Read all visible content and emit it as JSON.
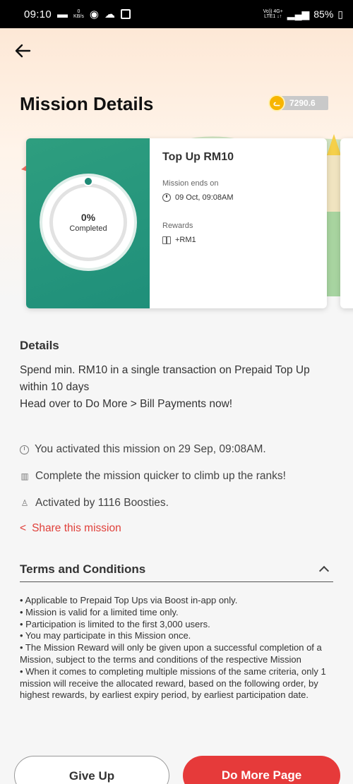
{
  "status_bar": {
    "time": "09:10",
    "notif_zero": "0",
    "notif_unit": "KB/s",
    "network_top": "Vo)) 4G+",
    "network_bottom": "LTE1 ↓↑",
    "battery": "85%"
  },
  "header": {
    "title": "Mission Details",
    "points": "7290.6"
  },
  "mission": {
    "progress_percent": "0%",
    "progress_label": "Completed",
    "title": "Top Up RM10",
    "ends_label": "Mission ends on",
    "ends_value": "09 Oct, 09:08AM",
    "rewards_label": "Rewards",
    "reward_value": "+RM1"
  },
  "details": {
    "title": "Details",
    "line1": "Spend min. RM10 in a single transaction on Prepaid Top Up within 10 days",
    "line2": "Head over to Do More > Bill Payments now!",
    "activated_on": "You activated this mission on 29 Sep, 09:08AM.",
    "ranks": "Complete the mission quicker to climb up the ranks!",
    "activated_by": "Activated by 1116 Boosties.",
    "share": "Share this mission"
  },
  "terms": {
    "title": "Terms and Conditions",
    "items": [
      "• Applicable to Prepaid Top Ups via Boost in-app only.",
      "• Mission is valid for a limited time only.",
      "• Participation is limited to the first 3,000 users.",
      "• You may participate in this Mission once.",
      "• The Mission Reward will only be given upon a successful completion of a Mission, subject to the terms and conditions of the respective Mission",
      "• When it comes to completing multiple missions of the same criteria, only 1 mission will receive the allocated reward, based on the following order, by highest rewards, by earliest expiry period, by earliest participation date."
    ]
  },
  "buttons": {
    "give_up": "Give Up",
    "do_more": "Do More Page"
  },
  "colors": {
    "accent_red": "#e63a3a",
    "card_green": "#1f8f7a",
    "coin_yellow": "#f7b500"
  }
}
